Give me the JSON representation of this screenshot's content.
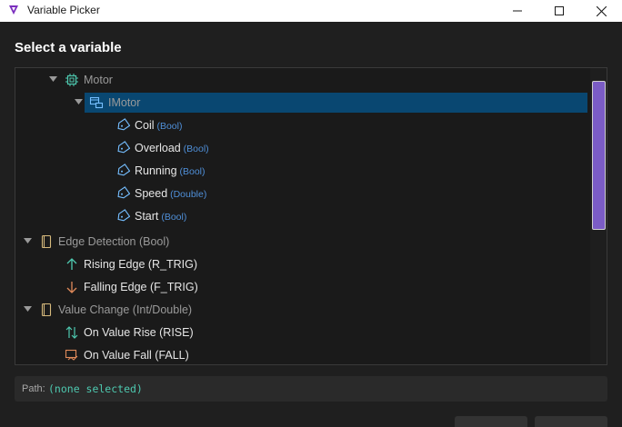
{
  "window": {
    "title": "Variable Picker",
    "accent_color": "#7b2fbe"
  },
  "dialog": {
    "heading": "Select a variable"
  },
  "tree": {
    "items": [
      {
        "label": "Motor",
        "type": "",
        "icon": "chip-icon",
        "depth": 1,
        "expanded": true,
        "selected": false
      },
      {
        "label": "IMotor",
        "type": "",
        "icon": "interface-icon",
        "depth": 2,
        "expanded": true,
        "selected": true
      },
      {
        "label": "Coil",
        "type": "(Bool)",
        "icon": "tag-icon",
        "depth": 3,
        "selected": false
      },
      {
        "label": "Overload",
        "type": "(Bool)",
        "icon": "tag-icon",
        "depth": 3,
        "selected": false
      },
      {
        "label": "Running",
        "type": "(Bool)",
        "icon": "tag-icon",
        "depth": 3,
        "selected": false
      },
      {
        "label": "Speed",
        "type": "(Double)",
        "icon": "tag-icon",
        "depth": 3,
        "selected": false
      },
      {
        "label": "Start",
        "type": "(Bool)",
        "icon": "tag-icon",
        "depth": 3,
        "selected": false
      },
      {
        "label": "Edge Detection (Bool)",
        "type": "",
        "icon": "category-icon",
        "depth": 0,
        "expanded": true,
        "selected": false
      },
      {
        "label": "Rising Edge (R_TRIG)",
        "type": "",
        "icon": "arrow-up-icon",
        "depth": 1,
        "selected": false
      },
      {
        "label": "Falling Edge (F_TRIG)",
        "type": "",
        "icon": "arrow-down-icon",
        "depth": 1,
        "selected": false
      },
      {
        "label": "Value Change (Int/Double)",
        "type": "",
        "icon": "category-icon",
        "depth": 0,
        "expanded": true,
        "selected": false
      },
      {
        "label": "On Value Rise (RISE)",
        "type": "",
        "icon": "up-down-arrows-icon",
        "depth": 1,
        "selected": false
      },
      {
        "label": "On Value Fall (FALL)",
        "type": "",
        "icon": "value-fall-icon",
        "depth": 1,
        "selected": false
      }
    ]
  },
  "path": {
    "label": "Path:",
    "value": "(none selected)"
  }
}
